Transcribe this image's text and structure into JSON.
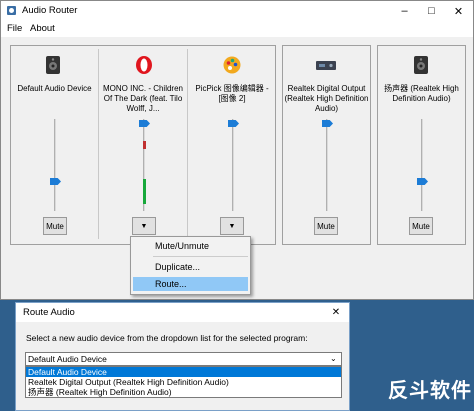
{
  "window": {
    "title": "Audio Router"
  },
  "menu": {
    "file": "File",
    "about": "About"
  },
  "devices": [
    {
      "label": "Default Audio Device",
      "icon": "speaker-icon",
      "button": "Mute"
    },
    {
      "label": "MONO INC. - Children Of The Dark (feat. Tilo Wolff, J...",
      "icon": "opera-icon",
      "button": "▼"
    },
    {
      "label": "PicPick 图像编辑器 - [图像 2]",
      "icon": "picpick-icon",
      "button": "▼"
    },
    {
      "label": "Realtek Digital Output (Realtek High Definition Audio)",
      "icon": "digital-output-icon",
      "button": "Mute"
    },
    {
      "label": "扬声器 (Realtek High Definition Audio)",
      "icon": "speaker-icon",
      "button": "Mute"
    }
  ],
  "context_menu": {
    "items": [
      "Mute/Unmute",
      "Duplicate...",
      "Route..."
    ],
    "highlighted": "Route..."
  },
  "dialog": {
    "title": "Route Audio",
    "prompt": "Select a new audio device from the dropdown list for the selected program:",
    "selected": "Default Audio Device",
    "options": [
      "Default Audio Device",
      "Realtek Digital Output (Realtek High Definition Audio)",
      "扬声器 (Realtek High Definition Audio)"
    ]
  },
  "watermark": "反斗软件",
  "colors": {
    "accent": "#1c7cd6",
    "vu": "#17a83a",
    "highlight": "#90c8f6",
    "desktop": "#2f5f8c"
  }
}
